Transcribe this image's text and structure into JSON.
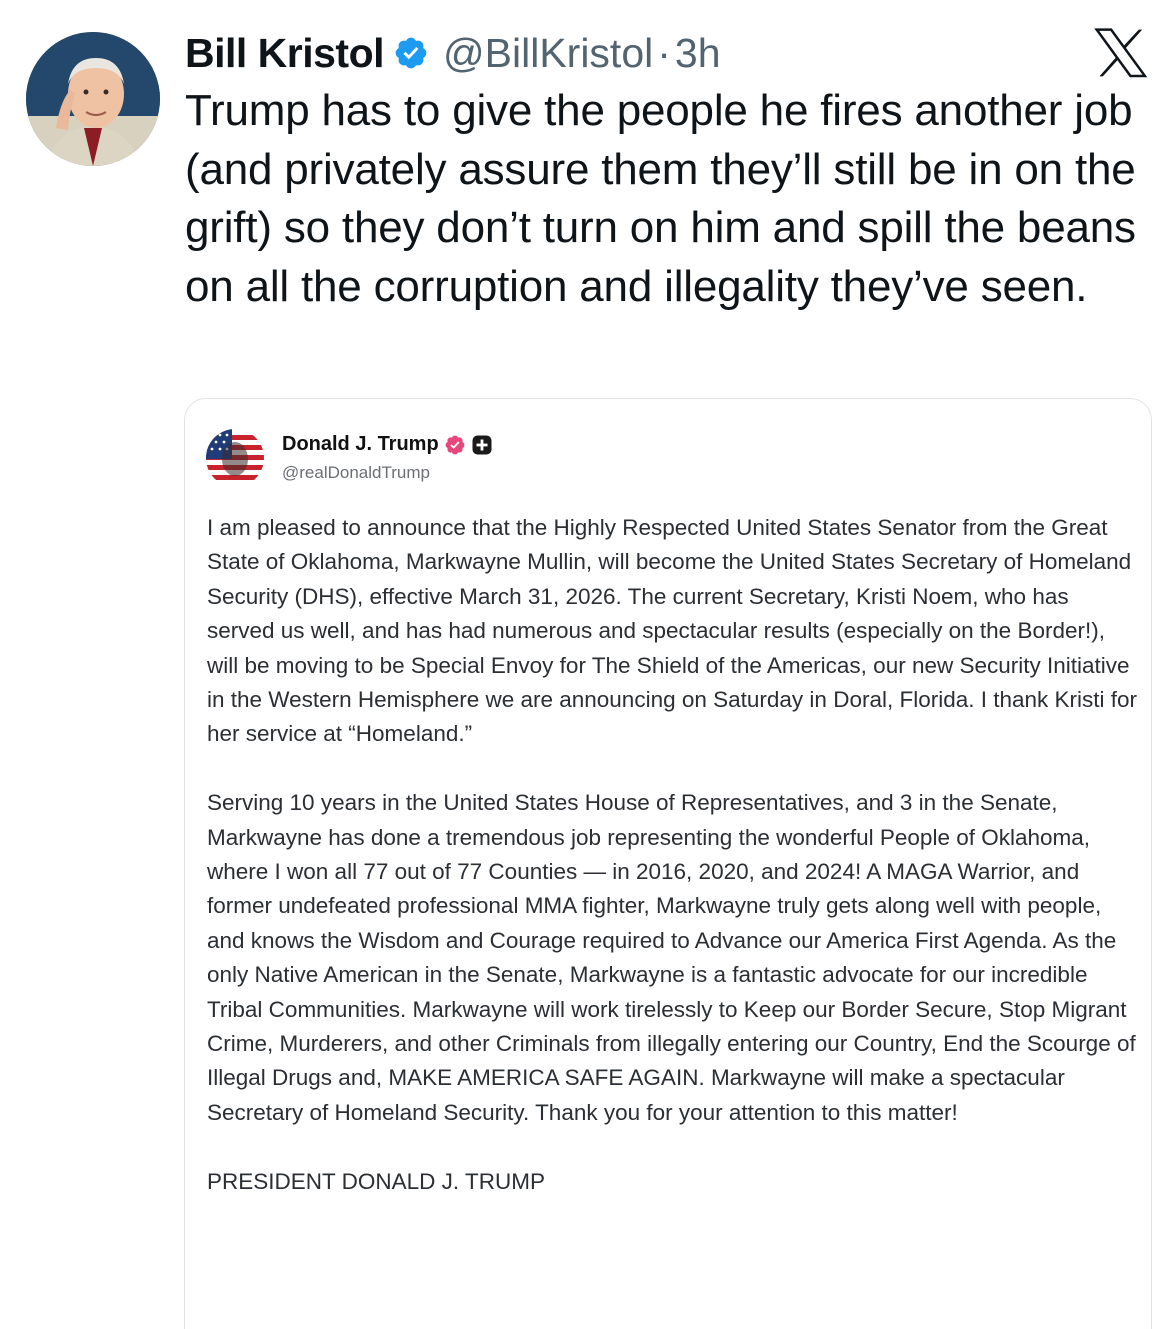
{
  "tweet": {
    "author": {
      "display_name": "Bill Kristol",
      "handle": "@BillKristol",
      "verified": true
    },
    "separator": "·",
    "time": "3h",
    "text": "Trump has to give the people he fires another job (and privately assure them they’ll still be in on the grift) so they don’t turn on him and spill the beans on all the corruption and illegality they’ve seen.",
    "platform_icon": "x-logo-icon"
  },
  "quote": {
    "author": {
      "display_name": "Donald J. Trump",
      "handle": "@realDonaldTrump"
    },
    "paragraphs": [
      "I am pleased to announce that the Highly Respected United States Senator from the Great State of Oklahoma, Markwayne Mullin, will become the United States Secretary of Homeland Security (DHS), effective March 31, 2026. The current Secretary, Kristi Noem, who has served us well, and has had numerous and spectacular results (especially on the Border!), will be moving to be Special Envoy for The Shield of the Americas, our new Security Initiative in the Western Hemisphere we are announcing on Saturday in Doral, Florida. I thank Kristi for her service at “Homeland.”",
      "Serving 10 years in the United States House of Representatives, and 3 in the Senate, Markwayne has done a tremendous job representing the wonderful People of Oklahoma, where I won all 77 out of 77 Counties — in 2016, 2020, and 2024! A MAGA Warrior, and former undefeated professional MMA fighter, Markwayne truly gets along well with people, and knows the Wisdom and Courage required to Advance our America First Agenda. As the only Native American in the Senate, Markwayne is a fantastic advocate for our incredible Tribal Communities. Markwayne will work tirelessly to Keep our Border Secure, Stop Migrant Crime, Murderers, and other Criminals from illegally entering our Country, End the Scourge of Illegal Drugs and, MAKE AMERICA SAFE AGAIN. Markwayne will make a spectacular Secretary of Homeland Security. Thank you for your attention to this matter!"
    ],
    "signature": "PRESIDENT DONALD J. TRUMP"
  },
  "colors": {
    "verified_blue": "#1d9bf0",
    "verified_pink": "#e8467c",
    "muted_text": "#536471",
    "card_border": "#dfe3e7"
  }
}
